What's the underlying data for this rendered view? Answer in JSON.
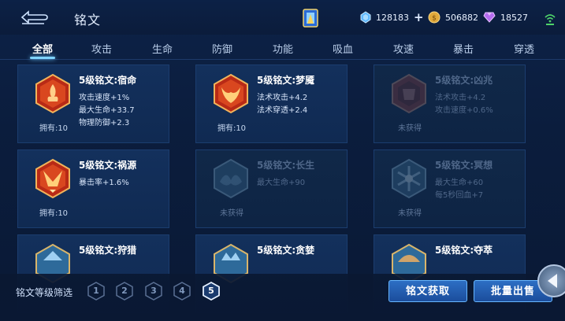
{
  "header": {
    "title": "铭文",
    "currencies": [
      {
        "icon": "blue-crystal-icon",
        "value": "128183",
        "has_plus": true
      },
      {
        "icon": "gold-coin-icon",
        "value": "506882",
        "has_plus": false
      },
      {
        "icon": "purple-diamond-icon",
        "value": "18527",
        "has_plus": false
      }
    ],
    "plus_label": "+"
  },
  "tabs": [
    {
      "label": "全部",
      "active": true
    },
    {
      "label": "攻击",
      "active": false
    },
    {
      "label": "生命",
      "active": false
    },
    {
      "label": "防御",
      "active": false
    },
    {
      "label": "功能",
      "active": false
    },
    {
      "label": "吸血",
      "active": false
    },
    {
      "label": "攻速",
      "active": false
    },
    {
      "label": "暴击",
      "active": false
    },
    {
      "label": "穿透",
      "active": false
    }
  ],
  "inscriptions": [
    {
      "name": "5级铭文:宿命",
      "stats": [
        "攻击速度+1%",
        "最大生命+33.7",
        "物理防御+2.3"
      ],
      "owned": "拥有:10",
      "locked": false,
      "color": "red"
    },
    {
      "name": "5级铭文:梦魇",
      "stats": [
        "法术攻击+4.2",
        "法术穿透+2.4"
      ],
      "owned": "拥有:10",
      "locked": false,
      "color": "red"
    },
    {
      "name": "5级铭文:凶兆",
      "stats": [
        "法术攻击+4.2",
        "攻击速度+0.6%"
      ],
      "owned": "未获得",
      "locked": true,
      "color": "red"
    },
    {
      "name": "5级铭文:祸源",
      "stats": [
        "暴击率+1.6%"
      ],
      "owned": "拥有:10",
      "locked": false,
      "color": "red"
    },
    {
      "name": "5级铭文:长生",
      "stats": [
        "最大生命+90"
      ],
      "owned": "未获得",
      "locked": true,
      "color": "blue"
    },
    {
      "name": "5级铭文:冥想",
      "stats": [
        "最大生命+60",
        "每5秒回血+7"
      ],
      "owned": "未获得",
      "locked": true,
      "color": "blue"
    },
    {
      "name": "5级铭文:狩猎",
      "stats": [],
      "owned": "",
      "locked": false,
      "color": "blue"
    },
    {
      "name": "5级铭文:贪婪",
      "stats": [],
      "owned": "",
      "locked": false,
      "color": "blue"
    },
    {
      "name": "5级铭文:夺萃",
      "stats": [],
      "owned": "",
      "locked": false,
      "color": "blue"
    }
  ],
  "footer": {
    "filter_label": "铭文等级筛选",
    "levels": [
      "1",
      "2",
      "3",
      "4",
      "5"
    ],
    "active_level": "5",
    "get_button": "铭文获取",
    "sell_button": "批量出售"
  },
  "colors": {
    "accent": "#6ac8ff",
    "button": "#2d6fc4",
    "red_emblem": "#c9341e",
    "blue_emblem": "#3d6a98"
  }
}
